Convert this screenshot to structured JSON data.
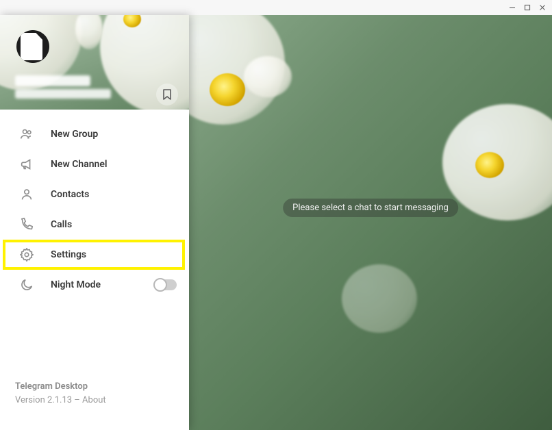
{
  "titlebar": {
    "minimize": "minimize",
    "maximize": "maximize",
    "close": "close"
  },
  "drawer": {
    "profile": {
      "name_redacted": "",
      "phone_redacted": ""
    },
    "bookmark_label": "Saved Messages",
    "items": [
      {
        "icon": "group-icon",
        "label": "New Group"
      },
      {
        "icon": "megaphone-icon",
        "label": "New Channel"
      },
      {
        "icon": "person-icon",
        "label": "Contacts"
      },
      {
        "icon": "phone-icon",
        "label": "Calls"
      },
      {
        "icon": "gear-icon",
        "label": "Settings",
        "highlighted": true
      },
      {
        "icon": "moon-icon",
        "label": "Night Mode",
        "toggle": false
      }
    ],
    "footer": {
      "app_name": "Telegram Desktop",
      "version_line": "Version 2.1.13 – About"
    }
  },
  "main": {
    "placeholder": "Please select a chat to start messaging"
  },
  "colors": {
    "highlight": "#fff200",
    "icon_gray": "#8f8f8f",
    "text_dark": "#3a3a3a"
  }
}
